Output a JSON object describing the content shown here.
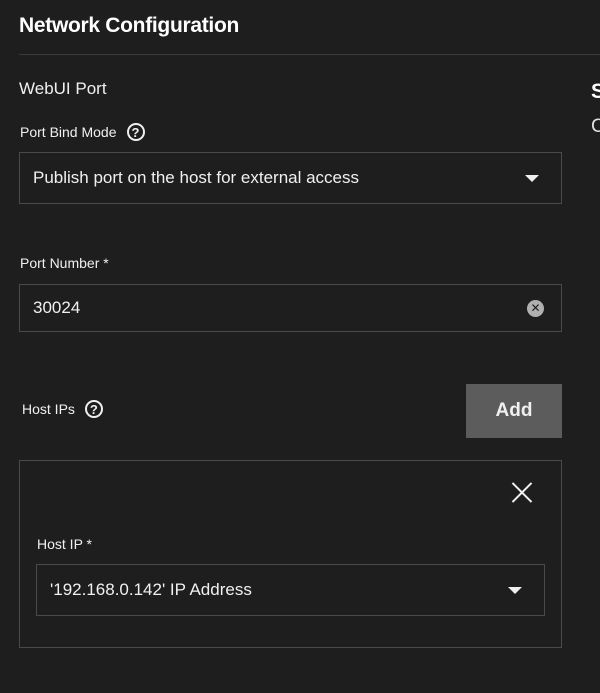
{
  "section": {
    "title": "Network Configuration",
    "subheading": "WebUI Port"
  },
  "right_panel": {
    "heading_fragment": "S",
    "sub_fragment": "C"
  },
  "port_bind_mode": {
    "label": "Port Bind Mode",
    "help_icon": "help-circle-icon",
    "value": "Publish port on the host for external access",
    "icon": "caret-down-icon"
  },
  "port_number": {
    "label": "Port Number *",
    "value": "30024",
    "clear_icon": "clear-circle-icon"
  },
  "host_ips": {
    "label": "Host IPs",
    "help_icon": "help-circle-icon",
    "add_label": "Add",
    "items": [
      {
        "label": "Host IP *",
        "value": "'192.168.0.142' IP Address",
        "remove_icon": "close-icon",
        "caret_icon": "caret-down-icon"
      }
    ]
  },
  "colors": {
    "background": "#1e1e1e",
    "border": "#4a4a4a",
    "button": "#5c5c5c",
    "text": "#f0f0f0"
  }
}
